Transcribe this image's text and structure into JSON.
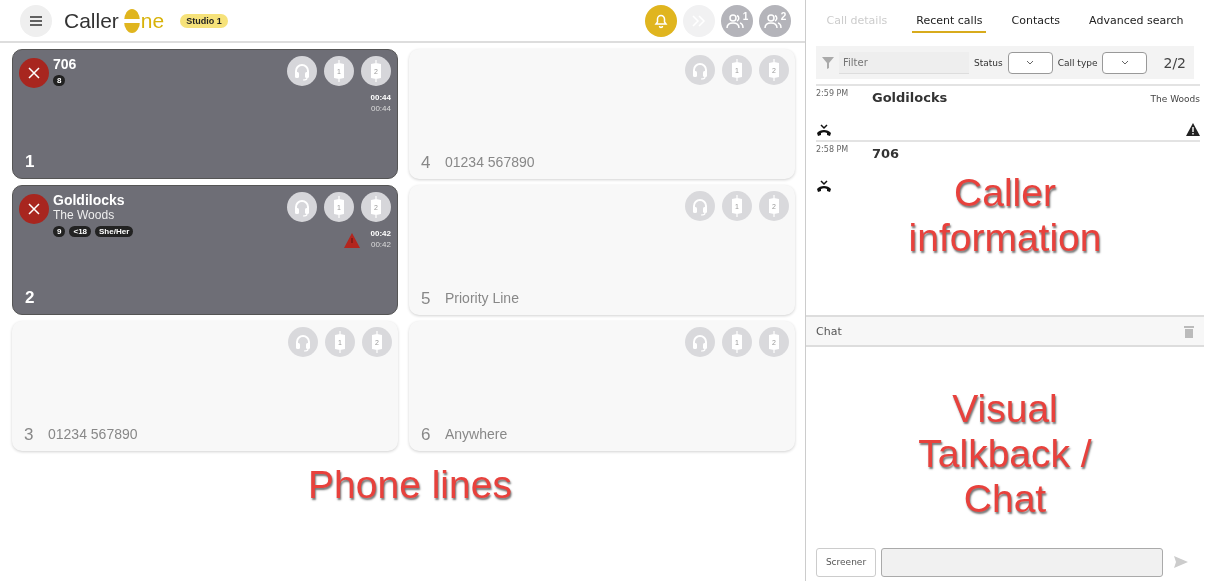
{
  "header": {
    "logo": {
      "prefix": "Caller",
      "suffix": "ne"
    },
    "studio": "Studio 1",
    "tools": [
      {
        "kind": "bell",
        "active": true
      },
      {
        "kind": "forward",
        "active": false,
        "disabled": true
      },
      {
        "kind": "people",
        "active": false,
        "badge": "1"
      },
      {
        "kind": "people",
        "active": false,
        "badge": "2"
      }
    ]
  },
  "lines": [
    {
      "number": "1",
      "kind": "active",
      "name": "706",
      "tags": [
        "8"
      ],
      "warning": false,
      "times": [
        "00:44",
        "00:44"
      ],
      "hybrids": [
        "1",
        "2"
      ]
    },
    {
      "number": "2",
      "kind": "active",
      "name": "Goldilocks",
      "location": "The Woods",
      "tags": [
        "9",
        "<18",
        "She/Her"
      ],
      "warning": true,
      "times": [
        "00:42",
        "00:42"
      ],
      "hybrids": [
        "1",
        "2"
      ]
    },
    {
      "number": "3",
      "kind": "idle",
      "label": "01234 567890",
      "hybrids": [
        "1",
        "2"
      ]
    },
    {
      "number": "4",
      "kind": "idle",
      "label": "01234 567890",
      "hybrids": [
        "1",
        "2"
      ]
    },
    {
      "number": "5",
      "kind": "idle",
      "label": "Priority Line",
      "hybrids": [
        "1",
        "2"
      ]
    },
    {
      "number": "6",
      "kind": "idle",
      "label": "Anywhere",
      "hybrids": [
        "1",
        "2"
      ]
    }
  ],
  "tabs": [
    {
      "label": "Call details",
      "selected": false,
      "disabled": true
    },
    {
      "label": "Recent calls",
      "selected": true,
      "disabled": false
    },
    {
      "label": "Contacts",
      "selected": false,
      "disabled": false
    },
    {
      "label": "Advanced search",
      "selected": false,
      "disabled": false
    }
  ],
  "filter": {
    "placeholder": "Filter",
    "status_label": "Status",
    "call_type_label": "Call type",
    "count": "2/2"
  },
  "recent_calls": [
    {
      "time": "2:59 PM",
      "name": "Goldilocks",
      "location": "The Woods",
      "warning": true
    },
    {
      "time": "2:58 PM",
      "name": "706",
      "warning": false
    }
  ],
  "chat": {
    "title": "Chat",
    "sender": "Screener"
  },
  "annotations": [
    "Phone lines",
    "Caller information",
    "Visual Talkback / Chat"
  ]
}
